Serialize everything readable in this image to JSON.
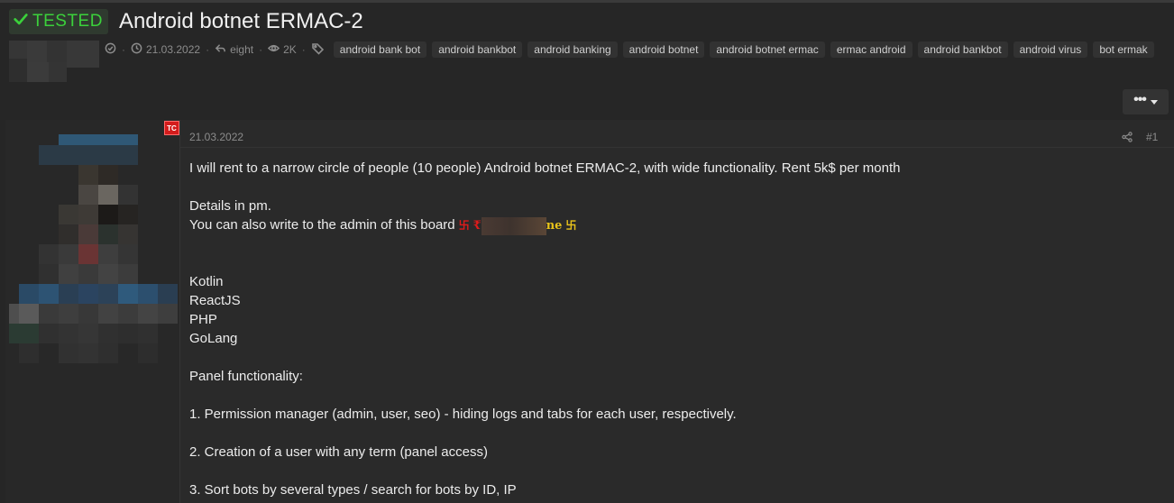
{
  "thread": {
    "prefix": "TESTED",
    "title": "Android botnet ERMAC-2",
    "date": "21.03.2022",
    "replies": "eight",
    "views": "2K",
    "tags": [
      "android bank bot",
      "android bankbot",
      "android banking",
      "android botnet",
      "android botnet ermac",
      "ermac android",
      "android bankbot",
      "android virus",
      "bot ermak"
    ],
    "more_label": "•••"
  },
  "colors": {
    "background": "#262626",
    "prefix_green": "#3bd13b",
    "badge_red": "#d31c1c",
    "admin_red": "#e01b1b",
    "admin_yellow": "#e8c21a"
  },
  "icons": {
    "prefix": "checkmark-icon",
    "status": "circle-check-icon",
    "date": "clock-icon",
    "replies": "reply-icon",
    "views": "eye-icon",
    "tags": "tag-icon",
    "share": "share-icon"
  },
  "post": {
    "badge": "TC",
    "date": "21.03.2022",
    "number": "#1",
    "lines": {
      "l1": "I will rent to a narrow circle of people (10 people) Android botnet ERMAC-2, with wide functionality. Rent 5k$ per month",
      "l2": "Details in pm.",
      "l3": "You can also write to the admin of this board",
      "l4": "Kotlin",
      "l5": "ReactJS",
      "l6": "PHP",
      "l7": "GoLang",
      "l8": "Panel functionality:",
      "l9": "1. Permission manager (admin, user, seo) - hiding logs and tabs for each user, respectively.",
      "l10": "2. Creation of a user with any term (panel access)",
      "l11": "3. Sort bots by several types / search for bots by ID, IP"
    },
    "admin_name": {
      "swastika": "卐",
      "first_letter": "₹",
      "suffix": "ne"
    }
  }
}
